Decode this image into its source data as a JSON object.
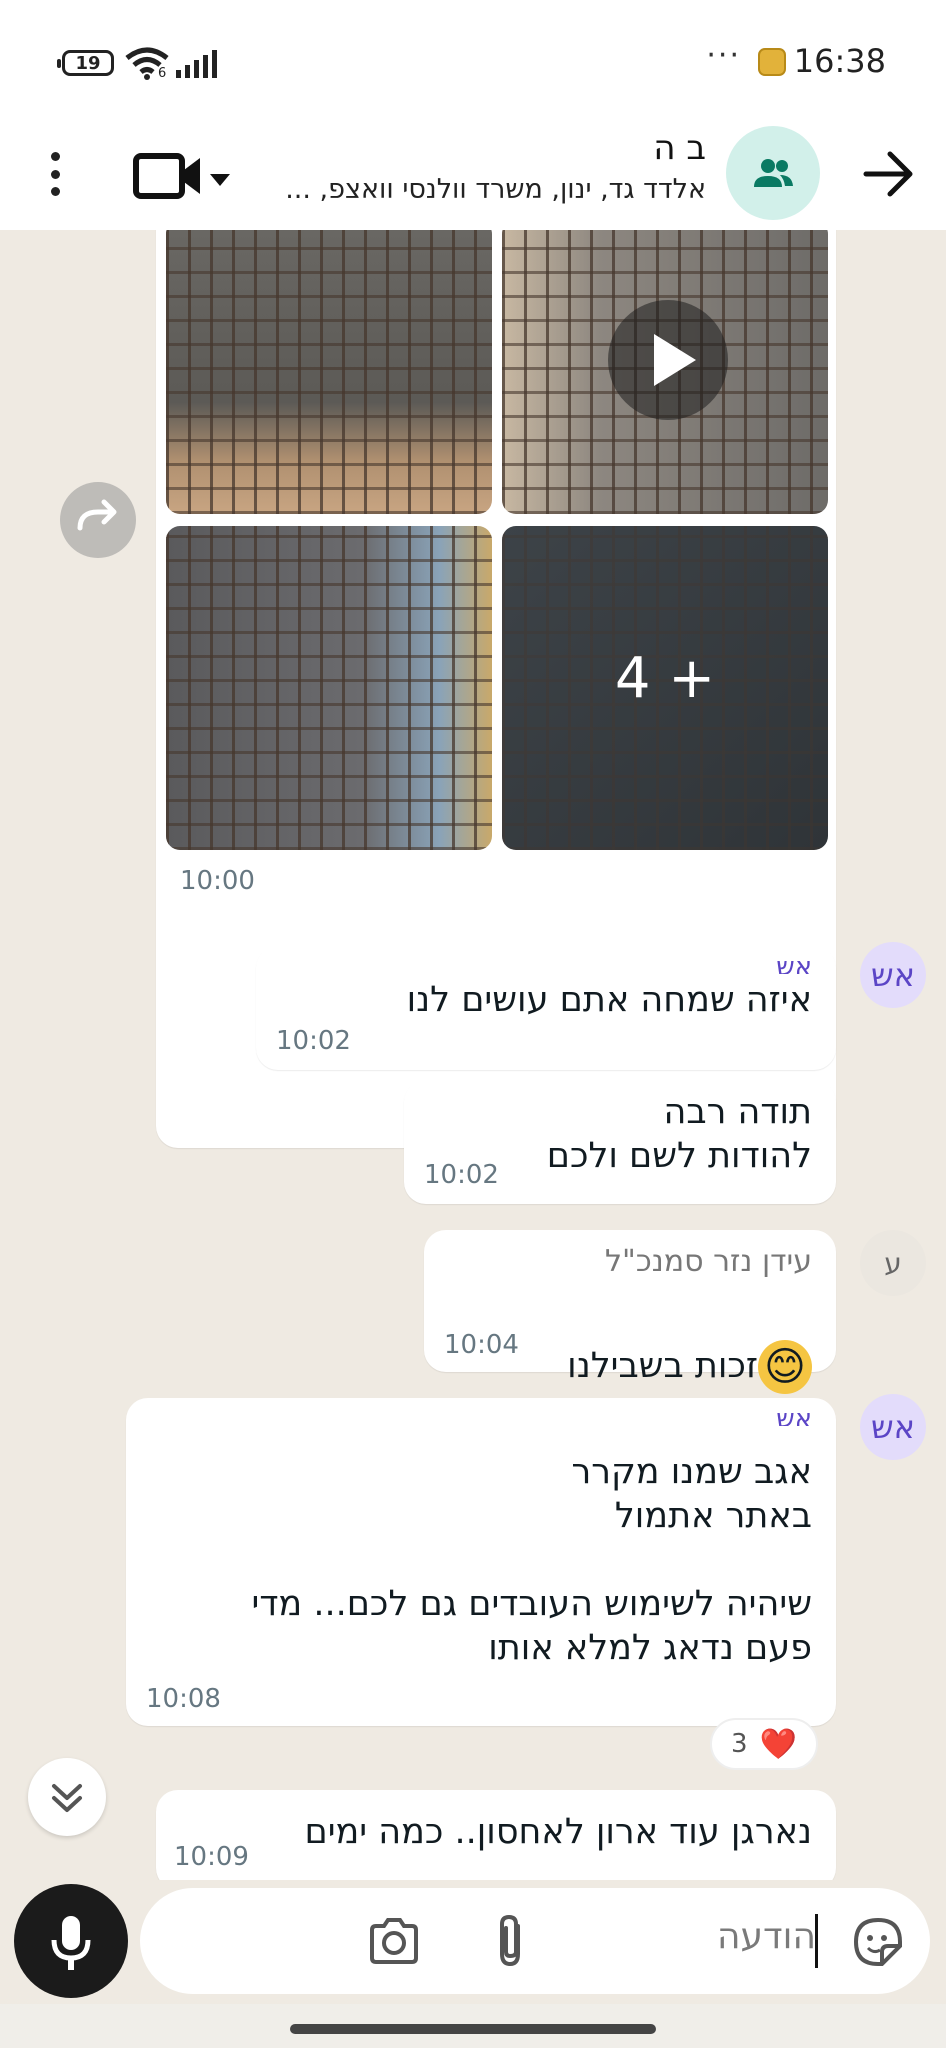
{
  "status_bar": {
    "battery": "19",
    "time": "16:38",
    "notif_dots": "···",
    "network_gen": "6"
  },
  "header": {
    "group_name": "ב          ה",
    "members": "אלדד גד, ינון, משרד וולנסי וואצפ, ..."
  },
  "media": {
    "more_count": "4 +",
    "time": "10:00"
  },
  "messages": [
    {
      "id": "m1",
      "sender": "אש",
      "sender_avatar": "אש",
      "text": "איזה שמחה אתם עושים לנו",
      "time": "10:02"
    },
    {
      "id": "m2",
      "text": "תודה רבה\nלהודות לשם ולכם",
      "time": "10:02"
    },
    {
      "id": "m3",
      "sender": "עידן נזר סמנכ\"ל",
      "sender_avatar": "ע",
      "text": "זכות בשבילנו",
      "emoji": "😊",
      "time": "10:04"
    },
    {
      "id": "m4",
      "sender": "אש",
      "sender_avatar": "אש",
      "text": "אגב שמנו מקרר\nבאתר אתמול\n\nשיהיה לשימוש העובדים גם לכם... מדי\nפעם נדאג למלא אותו",
      "time": "10:08",
      "reaction_emoji": "❤️",
      "reaction_count": "3"
    },
    {
      "id": "m5",
      "text": "נארגן עוד ארון לאחסון.. כמה ימים",
      "time": "10:09"
    }
  ],
  "input": {
    "placeholder": "הודעה"
  },
  "colors": {
    "chat_bg": "#efeae2",
    "bubble": "#ffffff",
    "group_avatar_bg": "#d2f0ea",
    "group_avatar_icon": "#0a7a63",
    "sender_avatar_bg": "#e3dcfb",
    "sender_avatar_text": "#5b45c6",
    "heart": "#e0262f"
  }
}
